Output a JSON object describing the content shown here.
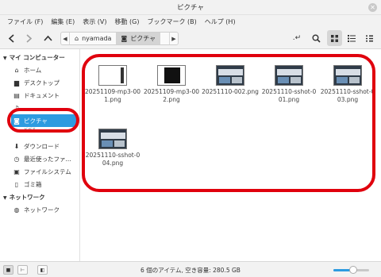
{
  "window": {
    "title": "ピクチャ"
  },
  "menu": [
    "ファイル (F)",
    "編集 (E)",
    "表示 (V)",
    "移動 (G)",
    "ブックマーク (B)",
    "ヘルプ (H)"
  ],
  "path": {
    "home": "nyamada",
    "current": "ピクチャ"
  },
  "sidebar": {
    "computer_label": "マイ コンピューター",
    "items": [
      {
        "label": "ホーム",
        "icon": "home-icon"
      },
      {
        "label": "デスクトップ",
        "icon": "desktop-icon"
      },
      {
        "label": "ドキュメント",
        "icon": "document-icon"
      },
      {
        "label": "",
        "icon": "music-icon"
      },
      {
        "label": "ピクチャ",
        "icon": "camera-icon",
        "selected": true
      },
      {
        "label": "ビデオ",
        "icon": "video-icon"
      },
      {
        "label": "ダウンロード",
        "icon": "download-icon"
      },
      {
        "label": "最近使ったファ...",
        "icon": "recent-icon"
      },
      {
        "label": "ファイルシステム",
        "icon": "drive-icon"
      },
      {
        "label": "ゴミ箱",
        "icon": "trash-icon"
      }
    ],
    "network_label": "ネットワーク",
    "network_items": [
      {
        "label": "ネットワーク",
        "icon": "network-icon"
      }
    ]
  },
  "files": [
    {
      "name": "20251109-mp3-001.png",
      "thumb": "white"
    },
    {
      "name": "20251109-mp3-002.png",
      "thumb": "black"
    },
    {
      "name": "20251110-002.png",
      "thumb": "screen"
    },
    {
      "name": "20251110-sshot-001.png",
      "thumb": "screen"
    },
    {
      "name": "20251110-sshot-003.png",
      "thumb": "screen"
    },
    {
      "name": "20251110-sshot-004.png",
      "thumb": "screen"
    }
  ],
  "status": {
    "text": "6 個のアイテム, 空き容量: 280.5 GB",
    "zoom_level": 0.55
  },
  "colors": {
    "accent": "#2d9be0",
    "annotation": "#e0000d"
  }
}
